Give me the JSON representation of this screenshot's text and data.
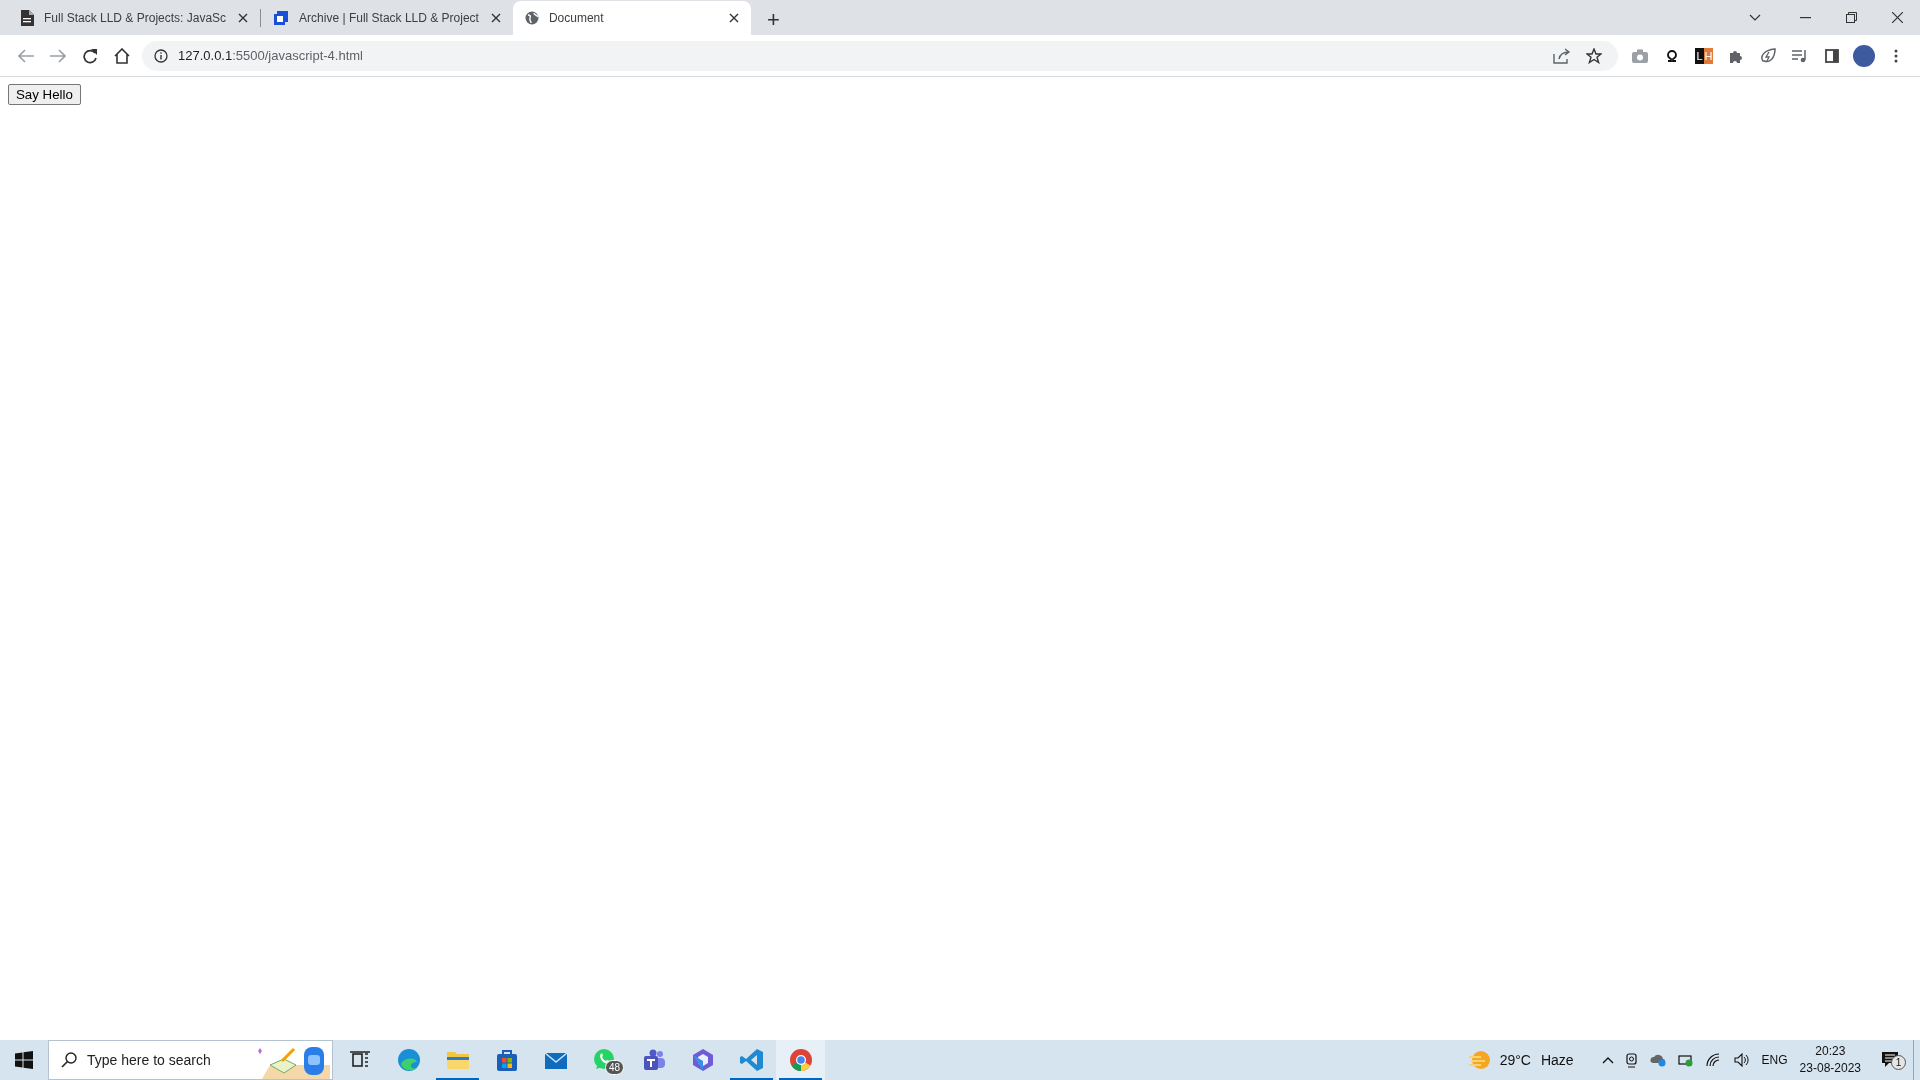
{
  "tabs": [
    {
      "title": "Full Stack LLD & Projects: JavaSc",
      "kind": "document",
      "selected": false
    },
    {
      "title": "Archive | Full Stack LLD & Project",
      "kind": "cube",
      "selected": false
    },
    {
      "title": "Document",
      "kind": "globe",
      "selected": true
    }
  ],
  "new_tab": "+",
  "address_bar": {
    "host": "127.0.0.1",
    "path": ":5500/javascript-4.html"
  },
  "extension_letters": [
    "L",
    "H"
  ],
  "page": {
    "button": "Say Hello"
  },
  "taskbar": {
    "search": {
      "placeholder": "Type here to search"
    },
    "apps": [
      {
        "kind": "taskview",
        "open": false,
        "selected": false
      },
      {
        "kind": "edge",
        "open": false,
        "selected": false
      },
      {
        "kind": "folder",
        "open": true,
        "selected": false
      },
      {
        "kind": "store",
        "open": false,
        "selected": false
      },
      {
        "kind": "mail",
        "open": false,
        "selected": false
      },
      {
        "kind": "chat",
        "open": false,
        "selected": false,
        "badge": "48"
      },
      {
        "kind": "teams",
        "open": false,
        "selected": false
      },
      {
        "kind": "hexagon",
        "open": false,
        "selected": false
      },
      {
        "kind": "code",
        "open": true,
        "selected": false
      },
      {
        "kind": "chrome",
        "open": true,
        "selected": true
      }
    ],
    "weather": {
      "temperature": "29°C",
      "condition": "Haze"
    },
    "language": "ENG",
    "time": "20:23",
    "date": "23-08-2023",
    "notification_count": "1"
  }
}
